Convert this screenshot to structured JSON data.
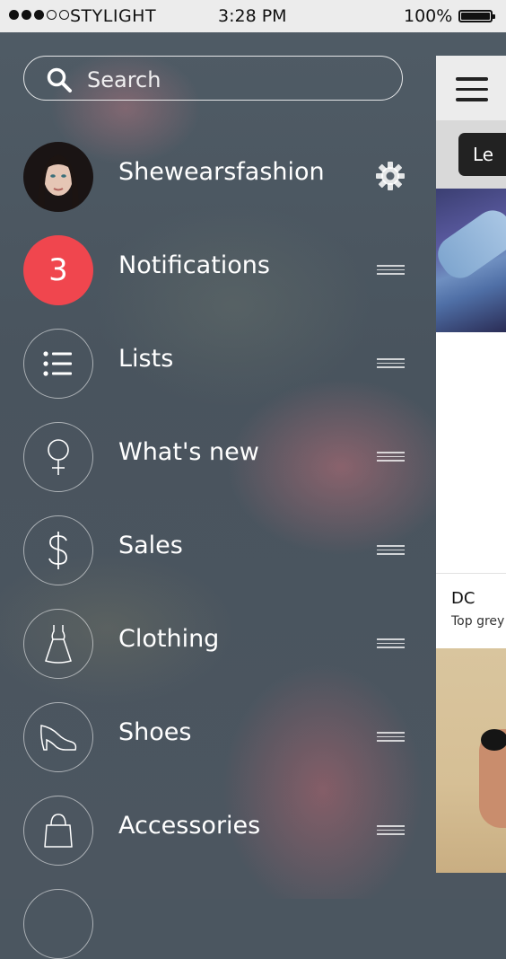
{
  "status_bar": {
    "carrier": "STYLIGHT",
    "time": "3:28 PM",
    "battery": "100%",
    "signal_bars_filled": 3,
    "signal_bars_total": 5
  },
  "search": {
    "placeholder": "Search"
  },
  "menu": {
    "profile": {
      "name": "Shewearsfashion",
      "icon": "gear-icon"
    },
    "items": [
      {
        "label": "Notifications",
        "badge": "3",
        "icon": "notification-badge"
      },
      {
        "label": "Lists",
        "icon": "list-icon"
      },
      {
        "label": "What's new",
        "icon": "female-symbol-icon"
      },
      {
        "label": "Sales",
        "icon": "dollar-icon"
      },
      {
        "label": "Clothing",
        "icon": "dress-icon"
      },
      {
        "label": "Shoes",
        "icon": "high-heel-icon"
      },
      {
        "label": "Accessories",
        "icon": "bag-icon"
      }
    ]
  },
  "panel": {
    "button_label": "Le",
    "product": {
      "brand": "DC",
      "description": "Top grey"
    }
  },
  "colors": {
    "accent_red": "#f0464e",
    "status_bg": "#ececec"
  }
}
